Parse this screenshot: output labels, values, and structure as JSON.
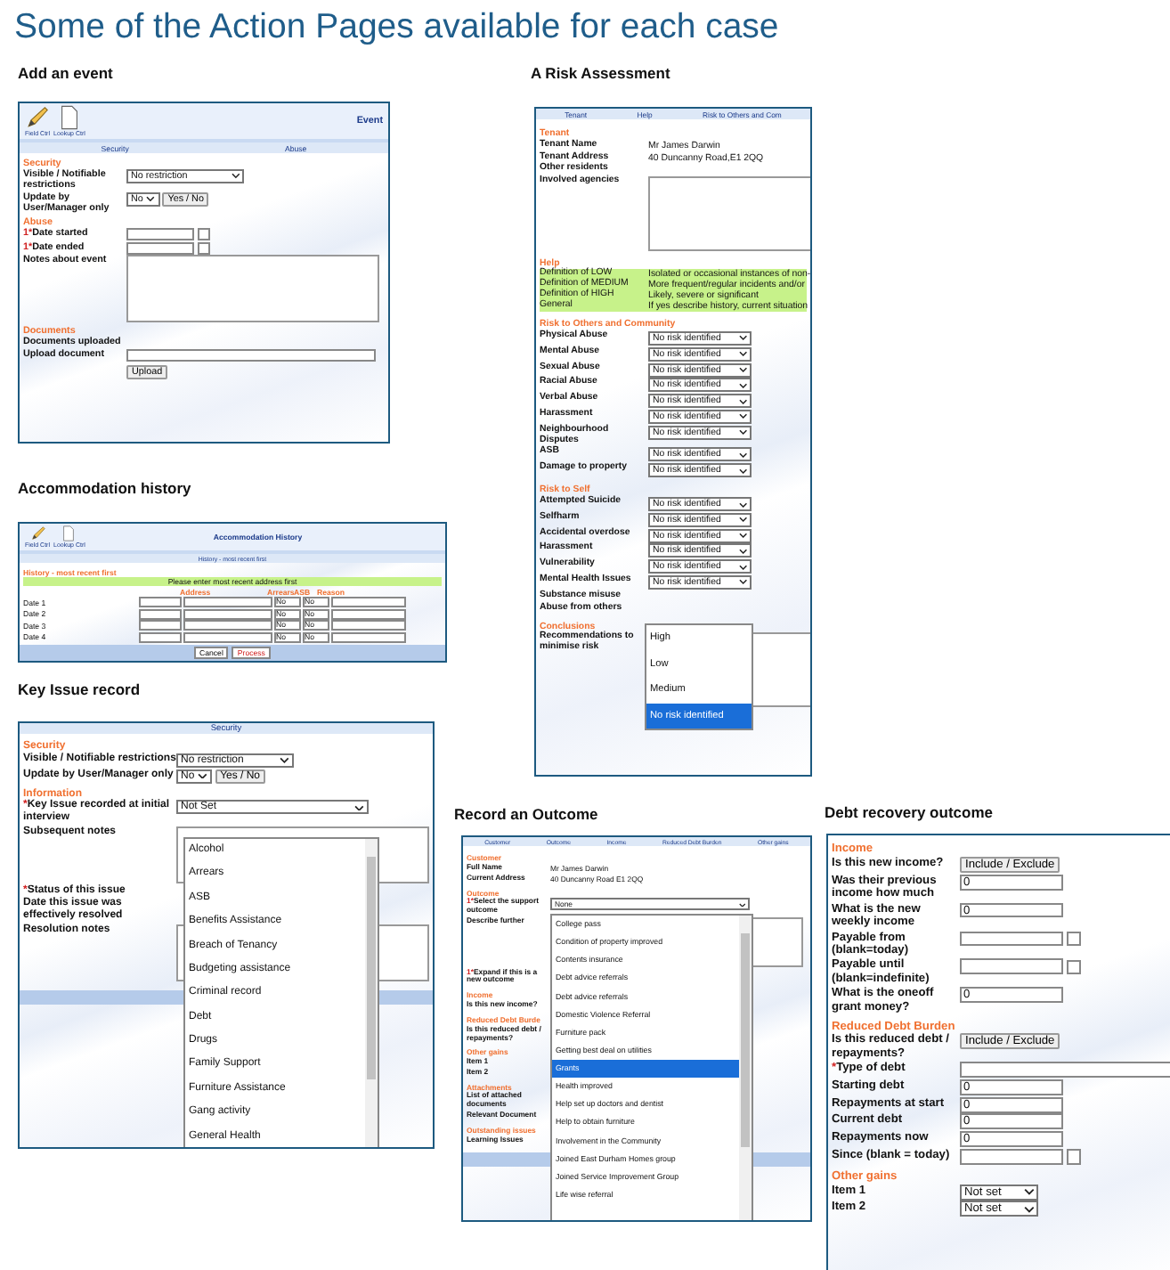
{
  "title": "Some of the Action Pages available for each case",
  "panels": [
    {
      "caption": "Add an event",
      "toolbar": {
        "tools": [
          {
            "kind": "pencil",
            "label": "Field Ctrl"
          },
          {
            "kind": "document",
            "label": "Lookup Ctrl"
          }
        ],
        "title": "Event"
      },
      "tabs": [
        "Security",
        "Abuse"
      ],
      "rows": [
        {
          "kind": "heading",
          "text": "Security"
        },
        {
          "kind": "select",
          "label": "Visible / Notifiable restrictions",
          "value": "No restriction"
        },
        {
          "kind": "select_button",
          "label": "Update by User/Manager only",
          "value": "No",
          "button": "Yes / No"
        },
        {
          "kind": "heading",
          "text": "Abuse"
        },
        {
          "kind": "date",
          "required": "1*",
          "label": "Date started"
        },
        {
          "kind": "date",
          "required": "1*",
          "label": "Date ended"
        },
        {
          "kind": "textarea",
          "label": "Notes about event"
        },
        {
          "kind": "heading",
          "text": "Documents"
        },
        {
          "kind": "label",
          "label": "Documents uploaded"
        },
        {
          "kind": "upload",
          "label": "Upload document",
          "button": "Upload"
        }
      ]
    },
    {
      "caption": "Accommodation history",
      "toolbar": {
        "tools": [
          {
            "kind": "pencil",
            "label": "Field Ctrl"
          },
          {
            "kind": "document",
            "label": "Lookup Ctrl"
          }
        ],
        "title": "Accommodation History"
      },
      "tabs": [
        "History - most recent first"
      ],
      "table": {
        "heading": "History - most recent first",
        "note": "Please enter most recent address first",
        "columns": [
          "Address",
          "Arrears",
          "ASB",
          "Reason"
        ],
        "rows": [
          {
            "label": "Date 1",
            "arrears": "No",
            "asb": "No"
          },
          {
            "label": "Date 2",
            "arrears": "No",
            "asb": "No"
          },
          {
            "label": "Date 3",
            "arrears": "No",
            "asb": "No"
          },
          {
            "label": "Date 4",
            "arrears": "No",
            "asb": "No"
          }
        ]
      },
      "footer": [
        {
          "label": "Cancel",
          "kind": "plain"
        },
        {
          "label": "Process",
          "kind": "primary"
        }
      ]
    },
    {
      "caption": "Key Issue record",
      "tabs": [
        "Security"
      ],
      "rows": [
        {
          "kind": "heading",
          "text": "Security"
        },
        {
          "kind": "select",
          "label": "Visible / Notifiable restrictions",
          "value": "No restriction"
        },
        {
          "kind": "select_button",
          "label": "Update by User/Manager only",
          "value": "No",
          "button": "Yes / No"
        },
        {
          "kind": "heading",
          "text": "Information"
        },
        {
          "kind": "wideselect",
          "required": "*",
          "label": "Key Issue recorded at initial interview",
          "value": "Not Set"
        },
        {
          "kind": "textarea",
          "label": "Subsequent notes"
        },
        {
          "kind": "label",
          "required": "*",
          "label": "Status of this issue"
        },
        {
          "kind": "label",
          "label": "Date this issue was effectively resolved"
        },
        {
          "kind": "textarea",
          "label": "Resolution notes"
        }
      ],
      "dropdown": {
        "options": [
          {
            "label": "Alcohol",
            "selected": false
          },
          {
            "label": "Arrears",
            "selected": false
          },
          {
            "label": "ASB",
            "selected": false
          },
          {
            "label": "Benefits Assistance",
            "selected": false
          },
          {
            "label": "Breach of Tenancy",
            "selected": false
          },
          {
            "label": "Budgeting assistance",
            "selected": false
          },
          {
            "label": "Criminal record",
            "selected": false
          },
          {
            "label": "Debt",
            "selected": false
          },
          {
            "label": "Drugs",
            "selected": false
          },
          {
            "label": "Family Support",
            "selected": false
          },
          {
            "label": "Furniture Assistance",
            "selected": false
          },
          {
            "label": "Gang activity",
            "selected": false
          },
          {
            "label": "General Health",
            "selected": false
          }
        ]
      }
    },
    {
      "caption": "A Risk Assessment",
      "tabs": [
        "Tenant",
        "Help",
        "Risk to Others and Com"
      ],
      "rows": [
        {
          "kind": "heading",
          "text": "Tenant"
        },
        {
          "kind": "text",
          "label": "Tenant Name",
          "value": "Mr James Darwin"
        },
        {
          "kind": "text",
          "label": "Tenant Address",
          "value": "40 Duncanny Road,E1 2QQ"
        },
        {
          "kind": "label",
          "label": "Other residents"
        },
        {
          "kind": "textarea",
          "label": "Involved agencies"
        },
        {
          "kind": "heading",
          "text": "Help"
        },
        {
          "kind": "help",
          "label": "Definition of LOW",
          "value": "Isolated or occasional instances of non-"
        },
        {
          "kind": "help",
          "label": "Definition of MEDIUM",
          "value": "More frequent/regular incidents and/or"
        },
        {
          "kind": "help",
          "label": "Definition of HIGH",
          "value": "Likely, severe or significant"
        },
        {
          "kind": "help",
          "label": "General",
          "value": "If yes describe history, current situation"
        },
        {
          "kind": "heading",
          "text": "Risk to Others and Community"
        },
        {
          "kind": "select",
          "label": "Physical Abuse",
          "value": "No risk identified"
        },
        {
          "kind": "select",
          "label": "Mental Abuse",
          "value": "No risk identified"
        },
        {
          "kind": "select",
          "label": "Sexual Abuse",
          "value": "No risk identified"
        },
        {
          "kind": "select",
          "label": "Racial Abuse",
          "value": "No risk identified"
        },
        {
          "kind": "select",
          "label": "Verbal Abuse",
          "value": "No risk identified"
        },
        {
          "kind": "select",
          "label": "Harassment",
          "value": "No risk identified"
        },
        {
          "kind": "select",
          "label": "Neighbourhood Disputes",
          "value": "No risk identified"
        },
        {
          "kind": "select",
          "label": "ASB",
          "value": "No risk identified"
        },
        {
          "kind": "select",
          "label": "Damage to property",
          "value": "No risk identified"
        },
        {
          "kind": "heading",
          "text": "Risk to Self"
        },
        {
          "kind": "select",
          "label": "Attempted Suicide",
          "value": "No risk identified"
        },
        {
          "kind": "select",
          "label": "Selfharm",
          "value": "No risk identified"
        },
        {
          "kind": "select",
          "label": "Accidental overdose",
          "value": "No risk identified"
        },
        {
          "kind": "select",
          "label": "Harassment",
          "value": "No risk identified"
        },
        {
          "kind": "select",
          "label": "Vulnerability",
          "value": "No risk identified"
        },
        {
          "kind": "select",
          "label": "Mental Health Issues",
          "value": "No risk identified"
        },
        {
          "kind": "label",
          "label": "Substance misuse"
        },
        {
          "kind": "label",
          "label": "Abuse from others"
        },
        {
          "kind": "heading",
          "text": "Conclusions"
        },
        {
          "kind": "textarea",
          "label": "Recommendations to minimise risk"
        }
      ],
      "dropdown": {
        "options": [
          {
            "label": "High",
            "selected": false
          },
          {
            "label": "Low",
            "selected": false
          },
          {
            "label": "Medium",
            "selected": false
          },
          {
            "label": "No risk identified",
            "selected": true
          }
        ]
      }
    },
    {
      "caption": "Record an Outcome",
      "tabs": [
        "Customer",
        "Outcome",
        "Income",
        "Reduced Debt Burden",
        "Other gains"
      ],
      "rows": [
        {
          "kind": "heading",
          "text": "Customer"
        },
        {
          "kind": "text",
          "label": "Full Name",
          "value": "Mr James Darwin"
        },
        {
          "kind": "text",
          "label": "Current Address",
          "value": "40 Duncanny Road E1 2QQ"
        },
        {
          "kind": "heading",
          "text": "Outcome"
        },
        {
          "kind": "wideselect",
          "required": "1*",
          "label": "Select the support outcome",
          "value": "None"
        },
        {
          "kind": "textarea",
          "label": "Describe further"
        },
        {
          "kind": "label",
          "required": "1*",
          "label": "Expand if this is a new outcome"
        },
        {
          "kind": "heading",
          "text": "Income"
        },
        {
          "kind": "label",
          "label": "Is this new income?"
        },
        {
          "kind": "heading",
          "text": "Reduced Debt Burde"
        },
        {
          "kind": "label",
          "label": "Is this reduced debt / repayments?"
        },
        {
          "kind": "heading",
          "text": "Other gains"
        },
        {
          "kind": "label",
          "label": "Item 1"
        },
        {
          "kind": "label",
          "label": "Item 2"
        },
        {
          "kind": "heading",
          "text": "Attachments"
        },
        {
          "kind": "label",
          "label": "List of attached documents"
        },
        {
          "kind": "label",
          "label": "Relevant Document"
        },
        {
          "kind": "heading",
          "text": "Outstanding issues"
        },
        {
          "kind": "label",
          "label": "Learning Issues"
        }
      ],
      "dropdown": {
        "options": [
          {
            "label": "College pass",
            "selected": false
          },
          {
            "label": "Condition of property improved",
            "selected": false
          },
          {
            "label": "Contents insurance",
            "selected": false
          },
          {
            "label": "Debt advice referrals",
            "selected": false
          },
          {
            "label": "Debt advice referrals",
            "selected": false
          },
          {
            "label": "Domestic Violence Referral",
            "selected": false
          },
          {
            "label": "Furniture pack",
            "selected": false
          },
          {
            "label": "Getting best deal on utilities",
            "selected": false
          },
          {
            "label": "Grants",
            "selected": true
          },
          {
            "label": "Health improved",
            "selected": false
          },
          {
            "label": "Help set up doctors and dentist",
            "selected": false
          },
          {
            "label": "Help to obtain furniture",
            "selected": false
          },
          {
            "label": "Involvement in the Community",
            "selected": false
          },
          {
            "label": "Joined East Durham Homes group",
            "selected": false
          },
          {
            "label": "Joined Service Improvement Group",
            "selected": false
          },
          {
            "label": "Life wise referral",
            "selected": false
          }
        ]
      }
    },
    {
      "caption": "Debt recovery outcome",
      "rows": [
        {
          "kind": "heading",
          "text": "Income"
        },
        {
          "kind": "button",
          "label": "Is this new income?",
          "button": "Include / Exclude"
        },
        {
          "kind": "input",
          "label": "Was their previous income how much",
          "value": "0"
        },
        {
          "kind": "input",
          "label": "What is the new weekly income",
          "value": "0"
        },
        {
          "kind": "date",
          "label": "Payable from (blank=today)"
        },
        {
          "kind": "date",
          "label": "Payable until (blank=indefinite)"
        },
        {
          "kind": "input",
          "label": "What is the oneoff grant money?",
          "value": "0"
        },
        {
          "kind": "heading",
          "text": "Reduced Debt Burden"
        },
        {
          "kind": "button",
          "label": "Is this reduced debt / repayments?",
          "button": "Include / Exclude"
        },
        {
          "kind": "wideinput",
          "required": "*",
          "label": "Type of debt"
        },
        {
          "kind": "input",
          "label": "Starting debt",
          "value": "0"
        },
        {
          "kind": "input",
          "label": "Repayments at start",
          "value": "0"
        },
        {
          "kind": "input",
          "label": "Current debt",
          "value": "0"
        },
        {
          "kind": "input",
          "label": "Repayments now",
          "value": "0"
        },
        {
          "kind": "date",
          "label": "Since (blank = today)"
        },
        {
          "kind": "heading",
          "text": "Other gains"
        },
        {
          "kind": "select",
          "label": "Item 1",
          "value": "Not set"
        },
        {
          "kind": "select",
          "label": "Item 2",
          "value": "Not set"
        }
      ]
    }
  ]
}
